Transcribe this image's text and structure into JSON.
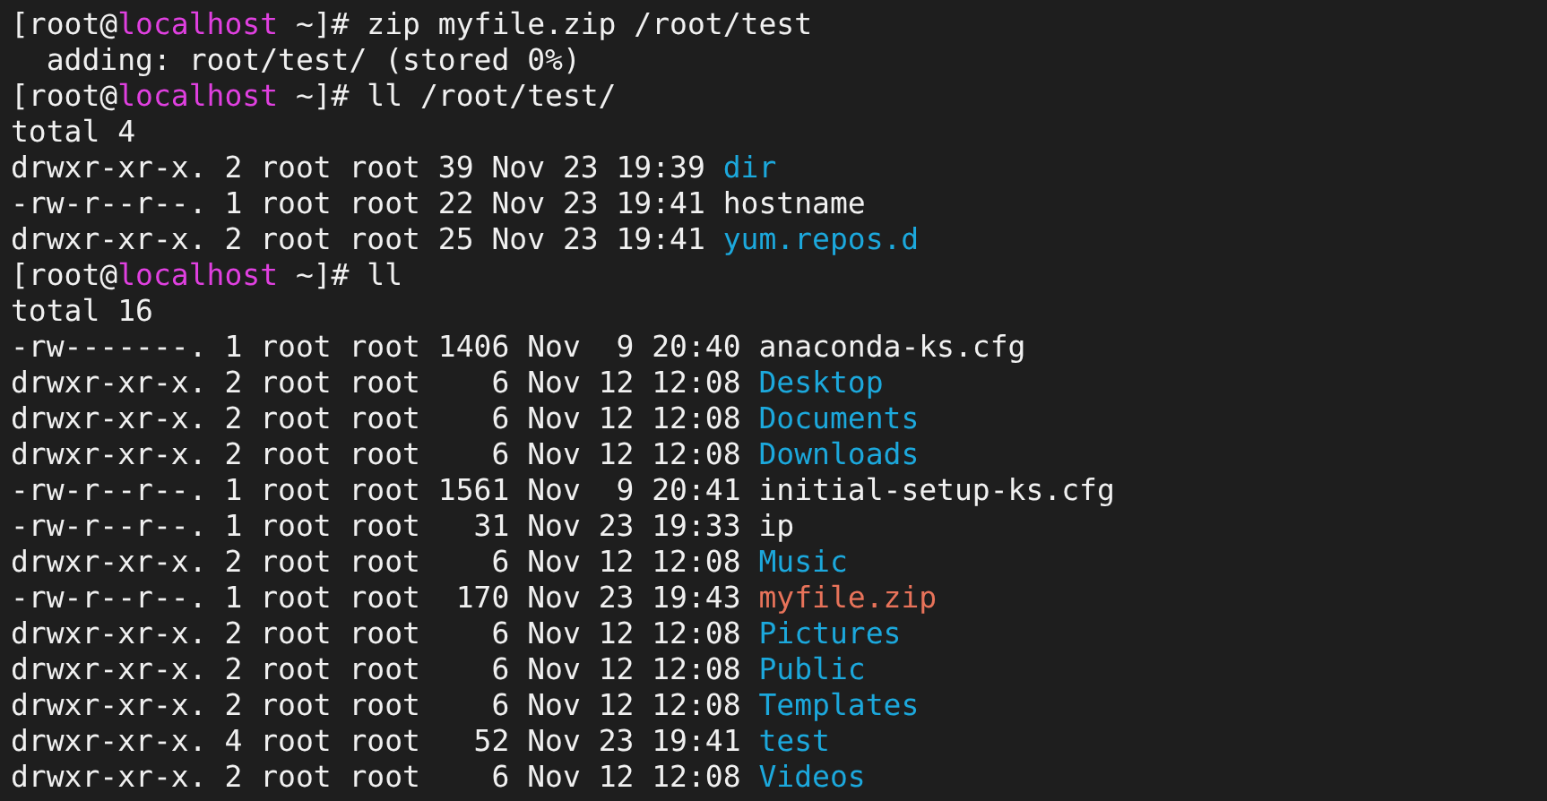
{
  "terminal": {
    "lines": [
      {
        "kind": "prompt",
        "user": "[root@",
        "host": "localhost",
        "path": "~]#",
        "command": "zip myfile.zip /root/test"
      },
      {
        "kind": "output",
        "text": "  adding: root/test/ (stored 0%)"
      },
      {
        "kind": "prompt",
        "user": "[root@",
        "host": "localhost",
        "path": "~]#",
        "command": "ll /root/test/"
      },
      {
        "kind": "output",
        "text": "total 4"
      },
      {
        "kind": "entry",
        "meta": "drwxr-xr-x. 2 root root 39 Nov 23 19:39",
        "name": "dir",
        "color": "#1ca8dc"
      },
      {
        "kind": "entry",
        "meta": "-rw-r--r--. 1 root root 22 Nov 23 19:41",
        "name": "hostname",
        "color": "#f0f0f0"
      },
      {
        "kind": "entry",
        "meta": "drwxr-xr-x. 2 root root 25 Nov 23 19:41",
        "name": "yum.repos.d",
        "color": "#1ca8dc"
      },
      {
        "kind": "prompt",
        "user": "[root@",
        "host": "localhost",
        "path": "~]#",
        "command": "ll"
      },
      {
        "kind": "output",
        "text": "total 16"
      },
      {
        "kind": "entry",
        "meta": "-rw-------. 1 root root 1406 Nov  9 20:40",
        "name": "anaconda-ks.cfg",
        "color": "#f0f0f0"
      },
      {
        "kind": "entry",
        "meta": "drwxr-xr-x. 2 root root    6 Nov 12 12:08",
        "name": "Desktop",
        "color": "#1ca8dc"
      },
      {
        "kind": "entry",
        "meta": "drwxr-xr-x. 2 root root    6 Nov 12 12:08",
        "name": "Documents",
        "color": "#1ca8dc"
      },
      {
        "kind": "entry",
        "meta": "drwxr-xr-x. 2 root root    6 Nov 12 12:08",
        "name": "Downloads",
        "color": "#1ca8dc"
      },
      {
        "kind": "entry",
        "meta": "-rw-r--r--. 1 root root 1561 Nov  9 20:41",
        "name": "initial-setup-ks.cfg",
        "color": "#f0f0f0"
      },
      {
        "kind": "entry",
        "meta": "-rw-r--r--. 1 root root   31 Nov 23 19:33",
        "name": "ip",
        "color": "#f0f0f0"
      },
      {
        "kind": "entry",
        "meta": "drwxr-xr-x. 2 root root    6 Nov 12 12:08",
        "name": "Music",
        "color": "#1ca8dc"
      },
      {
        "kind": "entry",
        "meta": "-rw-r--r--. 1 root root  170 Nov 23 19:43",
        "name": "myfile.zip",
        "color": "#e8735a"
      },
      {
        "kind": "entry",
        "meta": "drwxr-xr-x. 2 root root    6 Nov 12 12:08",
        "name": "Pictures",
        "color": "#1ca8dc"
      },
      {
        "kind": "entry",
        "meta": "drwxr-xr-x. 2 root root    6 Nov 12 12:08",
        "name": "Public",
        "color": "#1ca8dc"
      },
      {
        "kind": "entry",
        "meta": "drwxr-xr-x. 2 root root    6 Nov 12 12:08",
        "name": "Templates",
        "color": "#1ca8dc"
      },
      {
        "kind": "entry",
        "meta": "drwxr-xr-x. 4 root root   52 Nov 23 19:41",
        "name": "test",
        "color": "#1ca8dc"
      },
      {
        "kind": "entry",
        "meta": "drwxr-xr-x. 2 root root    6 Nov 12 12:08",
        "name": "Videos",
        "color": "#1ca8dc"
      }
    ]
  }
}
